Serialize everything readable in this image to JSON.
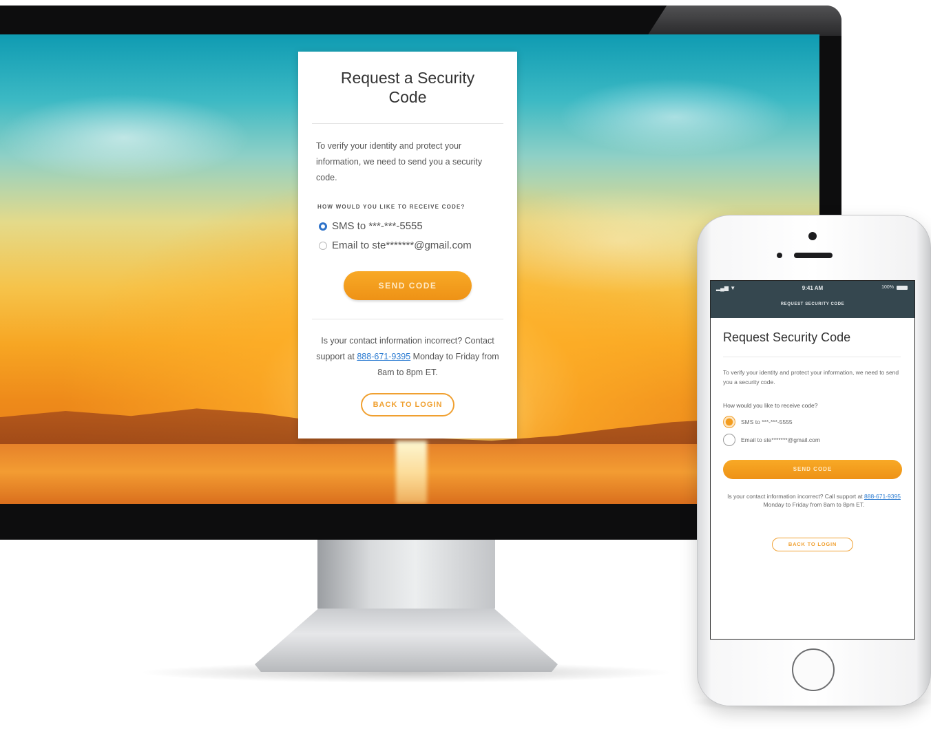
{
  "desktop": {
    "title": "Request a Security Code",
    "description": "To verify your identity and protect your information, we need to send you a security code.",
    "question": "HOW WOULD YOU LIKE TO RECEIVE CODE?",
    "options": [
      {
        "label": "SMS to ***-***-5555",
        "selected": true
      },
      {
        "label": "Email to ste*******@gmail.com",
        "selected": false
      }
    ],
    "send_button": "SEND CODE",
    "help_prefix": "Is your contact information incorrect? Contact support at ",
    "help_phone": "888-671-9395",
    "help_suffix": " Monday to Friday from 8am to 8pm ET.",
    "back_button": "BACK TO LOGIN"
  },
  "mobile": {
    "status_time": "9:41 AM",
    "status_battery": "100%",
    "status_signal": "▂▄▆ ▼",
    "nav_title": "REQUEST SECURITY CODE",
    "title": "Request Security Code",
    "description": "To verify your identity and protect your information, we need to send you a security code.",
    "question": "How would you like to receive code?",
    "options": [
      {
        "label": "SMS to ***-***-5555",
        "selected": true
      },
      {
        "label": "Email to ste*******@gmail.com",
        "selected": false
      }
    ],
    "send_button": "SEND CODE",
    "help_prefix": "Is your contact information incorrect? Call support at ",
    "help_phone": "888-671-9395",
    "help_suffix": " Monday to Friday from 8am to 8pm ET.",
    "back_button": "BACK TO LOGIN"
  },
  "colors": {
    "accent_orange": "#F39C1E",
    "radio_blue": "#2F73C9",
    "link_blue": "#2B7BD1",
    "mobile_header": "#35474F"
  }
}
